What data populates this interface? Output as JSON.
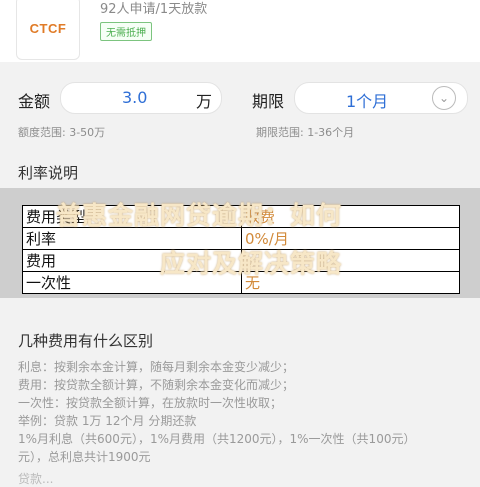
{
  "product": {
    "logo_text": "CTCF",
    "apply_info": "92人申请/1天放款",
    "tag": "无需抵押"
  },
  "form": {
    "amount_label": "金额",
    "amount_value": "3.0",
    "amount_unit": "万",
    "amount_range": "额度范围: 3-50万",
    "term_label": "期限",
    "term_value": "1个月",
    "term_range": "期限范围: 1-36个月"
  },
  "rate_section": {
    "title": "利率说明",
    "overlay_line1": "普惠金融网贷逾期：如何",
    "overlay_line2": "应对及解决策略",
    "rows": [
      {
        "label": "费用类型",
        "value": "收费"
      },
      {
        "label": "利率",
        "value": "0%/月"
      },
      {
        "label": "费用",
        "value": ""
      },
      {
        "label": "一次性",
        "value": "无"
      }
    ]
  },
  "diff_section": {
    "title": "几种费用有什么区别",
    "lines": [
      "利息：按剩余本金计算，随每月剩余本金变少减少；",
      "费用：按贷款全额计算，不随剩余本金变化而减少；",
      "一次性：按贷款全额计算，在放款时一次性收取；",
      "举例：贷款 1万 12个月 分期还款",
      "1%月利息（共600元），1%月费用（共1200元），1%一次性（共100元）",
      "元），总利息共计1900元"
    ],
    "cut_text": "贷款..."
  }
}
